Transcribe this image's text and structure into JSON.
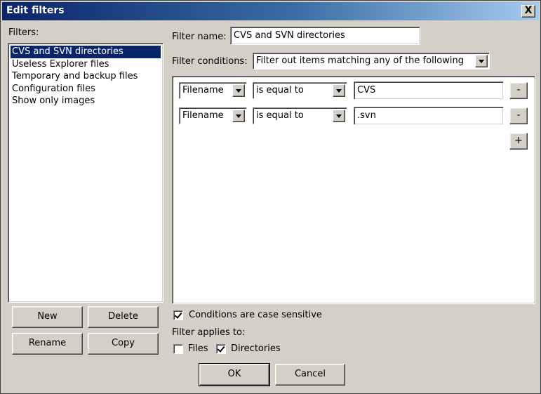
{
  "window": {
    "title": "Edit filters",
    "close_label": "X"
  },
  "filters_panel": {
    "label": "Filters:",
    "items": [
      {
        "label": "CVS and SVN directories",
        "selected": true
      },
      {
        "label": "Useless Explorer files"
      },
      {
        "label": "Temporary and backup files"
      },
      {
        "label": "Configuration files"
      },
      {
        "label": "Show only images"
      }
    ],
    "buttons": {
      "new": "New",
      "delete": "Delete",
      "rename": "Rename",
      "copy": "Copy"
    }
  },
  "filter_name": {
    "label": "Filter name:",
    "value": "CVS and SVN directories"
  },
  "filter_conditions": {
    "label": "Filter conditions:",
    "mode": "Filter out items matching any of the following",
    "rows": [
      {
        "field": "Filename",
        "operator": "is equal to",
        "value": "CVS",
        "remove_label": "-"
      },
      {
        "field": "Filename",
        "operator": "is equal to",
        "value": ".svn",
        "remove_label": "-"
      }
    ],
    "add_label": "+"
  },
  "options": {
    "case_sensitive": {
      "label": "Conditions are case sensitive",
      "checked": true
    },
    "applies_to_label": "Filter applies to:",
    "files": {
      "label": "Files",
      "checked": false
    },
    "directories": {
      "label": "Directories",
      "checked": true
    }
  },
  "footer": {
    "ok": "OK",
    "cancel": "Cancel"
  }
}
